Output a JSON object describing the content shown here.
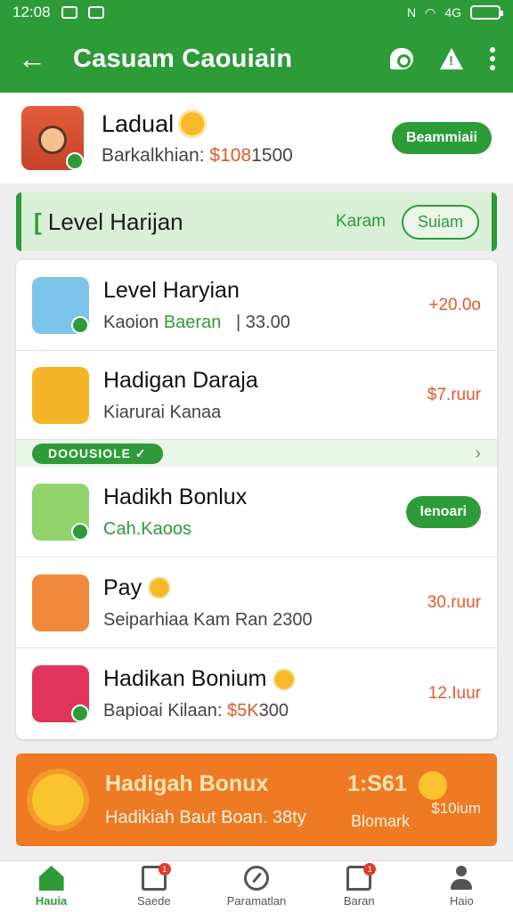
{
  "status_bar": {
    "time": "12:08",
    "network": "N",
    "signal": "4G"
  },
  "app_bar": {
    "title": "Casuam Caouiain"
  },
  "header": {
    "name": "Ladual",
    "subtitle": "Barkalkhian:",
    "amount": "$108",
    "amount_rest": "1500",
    "button_label": "Beammiaii"
  },
  "section": {
    "title": "Level Harijan",
    "link_label": "Karam",
    "pill_label": "Suiam"
  },
  "items": [
    {
      "title": "Level Haryian",
      "sub_a": "Kaoion",
      "sub_b": "Baeran",
      "sub_c": "| 33.00",
      "value": "+20.0o"
    },
    {
      "title": "Hadigan Daraja",
      "sub_a": "Kiarurai Kanaa",
      "value": "$7.ruur"
    },
    {
      "title": "Hadikh Bonlux",
      "sub_a": "Cah.Kaoos",
      "button_label": "Ienoari"
    },
    {
      "title": "Pay",
      "sub_a": "Seiparhiaa Kam Ran 2300",
      "value": "30.ruur"
    },
    {
      "title": "Hadikan Bonium",
      "sub_a": "Bapioai Kilaan:",
      "sub_b": "$5K",
      "sub_c": "300",
      "value": "12.Iuur"
    }
  ],
  "divider": {
    "tag_label": "DOOUSIOLE ✓"
  },
  "banner": {
    "title": "Hadigah Bonux",
    "subtitle": "Hadikiah Baut Boan. 38ty",
    "number": "1:S61",
    "small_value": "$10ium",
    "label": "Blomark"
  },
  "bottom_nav": [
    {
      "label": "Hauia",
      "active": true
    },
    {
      "label": "Saede",
      "badge": "1"
    },
    {
      "label": "Paramatlan"
    },
    {
      "label": "Baran",
      "badge": "1"
    },
    {
      "label": "Haio"
    }
  ],
  "colors": {
    "primary": "#2e9b39",
    "accent": "#e2582c",
    "banner": "#ee7a24"
  }
}
